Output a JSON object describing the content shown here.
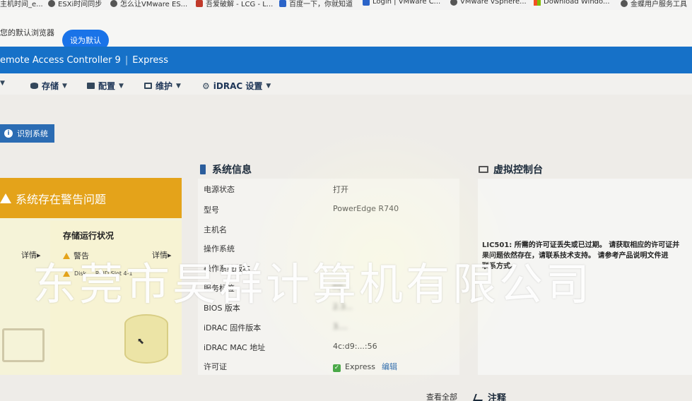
{
  "bookmarks": [
    {
      "label": "主机时间_e...",
      "icon": "doc-icon"
    },
    {
      "label": "ESXi时间同步",
      "icon": "globe-icon"
    },
    {
      "label": "怎么让VMware ES...",
      "icon": "globe-icon"
    },
    {
      "label": "吾爱破解 - LCG - L...",
      "icon": "red-square-icon"
    },
    {
      "label": "百度一下，你就知道",
      "icon": "baidu-paw-icon"
    },
    {
      "label": "Login | VMware C...",
      "icon": "vmware-icon"
    },
    {
      "label": "VMware vSphere...",
      "icon": "globe-icon"
    },
    {
      "label": "Download Windo...",
      "icon": "windows-icon"
    },
    {
      "label": "金蝶用户服务工具",
      "icon": "bird-icon"
    }
  ],
  "default_browser": {
    "message": "您的默认浏览器",
    "button": "设为默认"
  },
  "header": {
    "title": "emote Access Controller 9",
    "edition": "Express"
  },
  "nav": [
    {
      "label": "",
      "icon": "menu-icon"
    },
    {
      "label": "存储",
      "icon": "database-icon"
    },
    {
      "label": "配置",
      "icon": "config-icon"
    },
    {
      "label": "维护",
      "icon": "maintenance-icon"
    },
    {
      "label": "iDRAC 设置",
      "icon": "gear-icon"
    }
  ],
  "identify_button": "识别系统",
  "warning": {
    "banner": "系统存在警告问题",
    "storage_title": "存储运行状况",
    "detail_left": "详情",
    "detail_right": "详情",
    "status": "警告",
    "disk": "Disk ... RAID Slot 4-1"
  },
  "system_info": {
    "title": "系统信息",
    "rows": [
      {
        "label": "电源状态",
        "value": "打开"
      },
      {
        "label": "型号",
        "value": "PowerEdge R740"
      },
      {
        "label": "主机名",
        "value": ""
      },
      {
        "label": "操作系统",
        "value": ""
      },
      {
        "label": "操作系统版本",
        "value": ""
      },
      {
        "label": "服务标签",
        "value": "FD..."
      },
      {
        "label": "BIOS 版本",
        "value": "2.3..."
      },
      {
        "label": "iDRAC 固件版本",
        "value": "3...."
      },
      {
        "label": "iDRAC MAC 地址",
        "value": "4c:d9:...:56"
      },
      {
        "label": "许可证",
        "value": "Express"
      }
    ],
    "edit_link": "编辑"
  },
  "virtual_console": {
    "title": "虚拟控制台",
    "message_line1": "LIC501: 所需的许可证丢失或已过期。 请获取相应的许可证并",
    "message_line2": "果问题依然存在，请联系技术支持。 请参考产品说明文件进",
    "message_line3": "联系方式。"
  },
  "footer": {
    "view_all": "查看全部",
    "notes": "注释"
  },
  "watermark": "东莞市昊群计算机有限公司"
}
